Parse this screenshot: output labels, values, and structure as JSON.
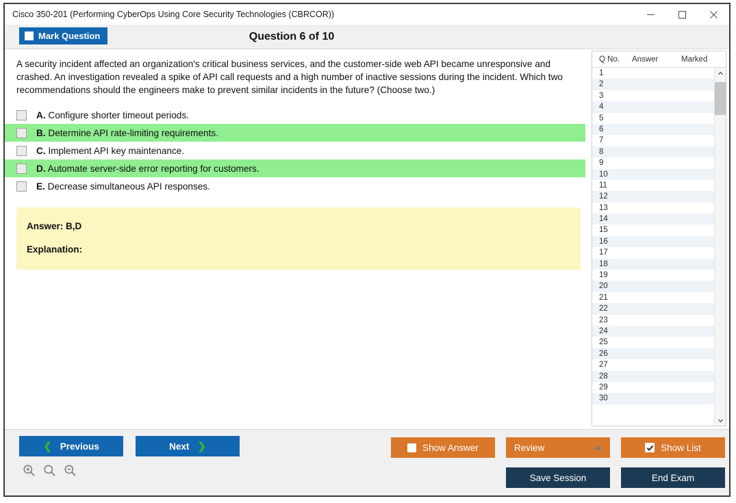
{
  "window": {
    "title": "Cisco 350-201 (Performing CyberOps Using Core Security Technologies (CBRCOR))",
    "controls": {
      "minimize": "minimize-icon",
      "maximize": "maximize-icon",
      "close": "close-icon"
    }
  },
  "header": {
    "mark_question_label": "Mark Question",
    "mark_question_checked": false,
    "question_title": "Question 6 of 10"
  },
  "question": {
    "text": "A security incident affected an organization's critical business services, and the customer-side web API became unresponsive and crashed. An investigation revealed a spike of API call requests and a high number of inactive sessions during the incident. Which two recommendations should the engineers make to prevent similar incidents in the future? (Choose two.)",
    "options": [
      {
        "letter": "A.",
        "text": "Configure shorter timeout periods.",
        "highlighted": false,
        "checked": false
      },
      {
        "letter": "B.",
        "text": "Determine API rate-limiting requirements.",
        "highlighted": true,
        "checked": false
      },
      {
        "letter": "C.",
        "text": "Implement API key maintenance.",
        "highlighted": false,
        "checked": false
      },
      {
        "letter": "D.",
        "text": "Automate server-side error reporting for customers.",
        "highlighted": true,
        "checked": false
      },
      {
        "letter": "E.",
        "text": "Decrease simultaneous API responses.",
        "highlighted": false,
        "checked": false
      }
    ],
    "answer_label": "Answer: B,D",
    "explanation_label": "Explanation:"
  },
  "question_list": {
    "columns": [
      "Q No.",
      "Answer",
      "Marked"
    ],
    "rows": [
      {
        "no": "1",
        "answer": "",
        "marked": ""
      },
      {
        "no": "2",
        "answer": "",
        "marked": ""
      },
      {
        "no": "3",
        "answer": "",
        "marked": ""
      },
      {
        "no": "4",
        "answer": "",
        "marked": ""
      },
      {
        "no": "5",
        "answer": "",
        "marked": ""
      },
      {
        "no": "6",
        "answer": "",
        "marked": ""
      },
      {
        "no": "7",
        "answer": "",
        "marked": ""
      },
      {
        "no": "8",
        "answer": "",
        "marked": ""
      },
      {
        "no": "9",
        "answer": "",
        "marked": ""
      },
      {
        "no": "10",
        "answer": "",
        "marked": ""
      },
      {
        "no": "11",
        "answer": "",
        "marked": ""
      },
      {
        "no": "12",
        "answer": "",
        "marked": ""
      },
      {
        "no": "13",
        "answer": "",
        "marked": ""
      },
      {
        "no": "14",
        "answer": "",
        "marked": ""
      },
      {
        "no": "15",
        "answer": "",
        "marked": ""
      },
      {
        "no": "16",
        "answer": "",
        "marked": ""
      },
      {
        "no": "17",
        "answer": "",
        "marked": ""
      },
      {
        "no": "18",
        "answer": "",
        "marked": ""
      },
      {
        "no": "19",
        "answer": "",
        "marked": ""
      },
      {
        "no": "20",
        "answer": "",
        "marked": ""
      },
      {
        "no": "21",
        "answer": "",
        "marked": ""
      },
      {
        "no": "22",
        "answer": "",
        "marked": ""
      },
      {
        "no": "23",
        "answer": "",
        "marked": ""
      },
      {
        "no": "24",
        "answer": "",
        "marked": ""
      },
      {
        "no": "25",
        "answer": "",
        "marked": ""
      },
      {
        "no": "26",
        "answer": "",
        "marked": ""
      },
      {
        "no": "27",
        "answer": "",
        "marked": ""
      },
      {
        "no": "28",
        "answer": "",
        "marked": ""
      },
      {
        "no": "29",
        "answer": "",
        "marked": ""
      },
      {
        "no": "30",
        "answer": "",
        "marked": ""
      }
    ]
  },
  "footer": {
    "previous_label": "Previous",
    "next_label": "Next",
    "show_answer_label": "Show Answer",
    "show_answer_checked": false,
    "review_label": "Review",
    "show_list_label": "Show List",
    "show_list_checked": true,
    "save_session_label": "Save Session",
    "end_exam_label": "End Exam",
    "zoom_icons": [
      "zoom-in-icon",
      "zoom-reset-icon",
      "zoom-out-icon"
    ]
  },
  "colors": {
    "primary_blue": "#1366b0",
    "accent_green": "#2fb82f",
    "highlight_green": "#90ee90",
    "answer_yellow": "#fcf6c0",
    "orange": "#d9772b",
    "dark_navy": "#1d3a54"
  }
}
